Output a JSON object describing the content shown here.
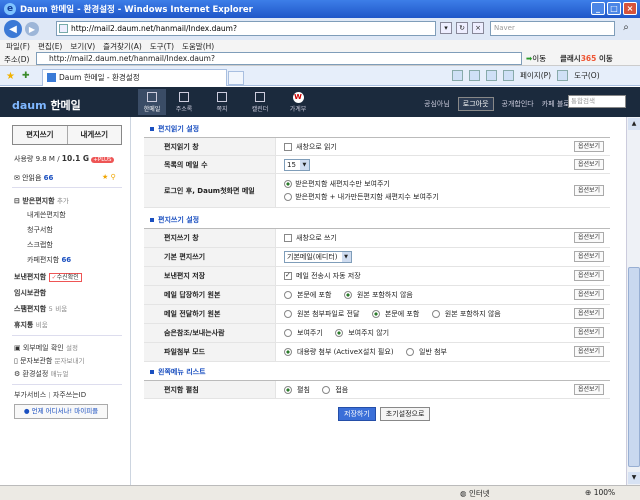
{
  "window": {
    "title": "Daum 한메일 - 환경설정 - Windows Internet Explorer",
    "url": "http://mail2.daum.net/hanmail/Index.daum?",
    "search_placeholder": "Naver"
  },
  "menu": [
    "파일(F)",
    "편집(E)",
    "보기(V)",
    "즐겨찾기(A)",
    "도구(T)",
    "도움말(H)"
  ],
  "addressbar": {
    "label": "주소(D)",
    "url": "http://mail2.daum.net/hanmail/Index.daum?",
    "go": "이동",
    "brand_pre": "클래시",
    "brand_num": "365",
    "brand_post": "이동"
  },
  "tab": {
    "title": "Daum 한메일 - 환경설정"
  },
  "tools": {
    "page": "페이지(P)",
    "tools": "도구(O)"
  },
  "daum": {
    "logo_prefix": "daum",
    "logo": "한메일",
    "nav": [
      "한메일",
      "주소록",
      "쪽지",
      "캘린더",
      "가계부"
    ],
    "toplinks": {
      "common": "공심아님",
      "logout": "로그아웃",
      "shared": "공개합인다",
      "cafe": "카페 블로그"
    },
    "search_placeholder": "통합검색"
  },
  "sidebar": {
    "write": "편지쓰기",
    "self": "내게쓰기",
    "usage_label": "사용량",
    "usage_used": "9.8 M",
    "usage_total": "10.1 G",
    "plus": "+PLUS",
    "unread_label": "안읽음",
    "unread_count": "66",
    "inbox": "받은편지함",
    "add": "추가",
    "sub1": "내게쓴편지함",
    "sub2": "청구서함",
    "sub3": "스크랩함",
    "sub4": "카페편지함",
    "sub4_count": "66",
    "sent": "보낸편지함",
    "sent_check": "수신확인",
    "temp": "임시보관함",
    "spam": "스팸편지함",
    "spam_count": "5",
    "spam_empty": "비움",
    "trash": "휴지통",
    "trash_empty": "비움",
    "ext_mail": "외부메일 확인",
    "ext_set": "설정",
    "sms": "문자보관함",
    "sms_send": "문자보내기",
    "settings": "환경설정",
    "manual": "매뉴얼",
    "extra": "부가서비스",
    "faq": "자주쓰는ID",
    "banner_pre": "언제 어디서나!",
    "banner": "마이피플"
  },
  "sections": {
    "read": {
      "title": "편지읽기 설정",
      "rows": [
        {
          "label": "편지읽기 창",
          "opt": "새창으로 읽기"
        },
        {
          "label": "목록의 메일 수",
          "value": "15"
        },
        {
          "label": "로그인 후, Daum첫화면 메일",
          "opt1": "받은편지함 새편지수만 보여주기",
          "opt2": "받은편지함 + 내가만든편지함 새편지수 보여주기"
        }
      ]
    },
    "write": {
      "title": "편지쓰기 설정",
      "rows": [
        {
          "label": "편지쓰기 창",
          "opt": "새창으로 쓰기"
        },
        {
          "label": "기본 편지쓰기",
          "value": "기본메일(에디터)"
        },
        {
          "label": "보낸편지 저장",
          "opt": "메일 전송시 자동 저장"
        },
        {
          "label": "메일 답장하기 원본",
          "opt1": "본문에 포함",
          "opt2": "원본 포함하지 않음"
        },
        {
          "label": "메일 전달하기 원본",
          "opt1": "원본 첨부파일로 전달",
          "opt2": "본문에 포함",
          "opt3": "원본 포함하지 않음"
        },
        {
          "label": "숨은참조/보내는사람",
          "opt1": "보여주기",
          "opt2": "보여주지 않기"
        },
        {
          "label": "파일첨부 모드",
          "opt1": "대용량 첨부 (ActiveX설치 필요)",
          "opt2": "일반 첨부"
        }
      ]
    },
    "expand": {
      "title": "왼쪽메뉴 리스트",
      "rows": [
        {
          "label": "편지함 펼침",
          "opt1": "펼침",
          "opt2": "접음"
        }
      ]
    },
    "help": "옵션보기"
  },
  "actions": {
    "save": "저장하기",
    "reset": "초기설정으로"
  },
  "status": {
    "zone": "인터넷",
    "zoom": "100%"
  }
}
